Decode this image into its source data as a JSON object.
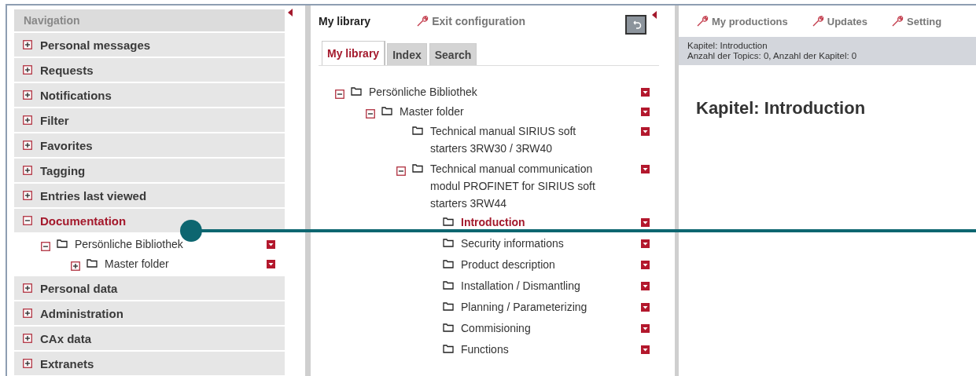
{
  "navigation": {
    "title": "Navigation",
    "items": [
      {
        "label": "Personal messages",
        "expanded": false
      },
      {
        "label": "Requests",
        "expanded": false
      },
      {
        "label": "Notifications",
        "expanded": false
      },
      {
        "label": "Filter",
        "expanded": false
      },
      {
        "label": "Favorites",
        "expanded": false
      },
      {
        "label": "Tagging",
        "expanded": false
      },
      {
        "label": "Entries last viewed",
        "expanded": false
      },
      {
        "label": "Documentation",
        "expanded": true,
        "children": [
          {
            "label": "Persönliche Bibliothek",
            "expanded": true,
            "selected": false,
            "children": [
              {
                "label": "Master folder",
                "expanded": false,
                "selected": false
              }
            ]
          }
        ]
      },
      {
        "label": "Personal data",
        "expanded": false
      },
      {
        "label": "Administration",
        "expanded": false
      },
      {
        "label": "CAx data",
        "expanded": false
      },
      {
        "label": "Extranets",
        "expanded": false
      }
    ]
  },
  "library": {
    "title": "My library",
    "exit_link": "Exit configuration",
    "tabs": [
      {
        "label": "My library",
        "selected": true
      },
      {
        "label": "Index",
        "selected": false
      },
      {
        "label": "Search",
        "selected": false
      }
    ],
    "tree": [
      {
        "label": "Persönliche Bibliothek",
        "expanded": true,
        "selected": false,
        "children": [
          {
            "label": "Master folder",
            "expanded": true,
            "selected": false,
            "children": [
              {
                "label": "Technical manual SIRIUS soft starters 3RW30 / 3RW40",
                "selected": false
              },
              {
                "label": "Technical manual communication modul PROFINET for SIRIUS soft starters 3RW44",
                "expanded": true,
                "selected": false,
                "children": [
                  {
                    "label": "Introduction",
                    "selected": true
                  },
                  {
                    "label": "Security informations",
                    "selected": false
                  },
                  {
                    "label": "Product description",
                    "selected": false
                  },
                  {
                    "label": "Installation / Dismantling",
                    "selected": false
                  },
                  {
                    "label": "Planning / Parameterizing",
                    "selected": false
                  },
                  {
                    "label": "Commisioning",
                    "selected": false
                  },
                  {
                    "label": "Functions",
                    "selected": false
                  }
                ]
              }
            ]
          }
        ]
      }
    ]
  },
  "content": {
    "toolbar": [
      "My productions",
      "Updates",
      "Setting"
    ],
    "info_lines": [
      "Kapitel: Introduction",
      "Anzahl der Topics: 0, Anzahl der Kapitel: 0"
    ],
    "heading": "Kapitel: Introduction"
  }
}
